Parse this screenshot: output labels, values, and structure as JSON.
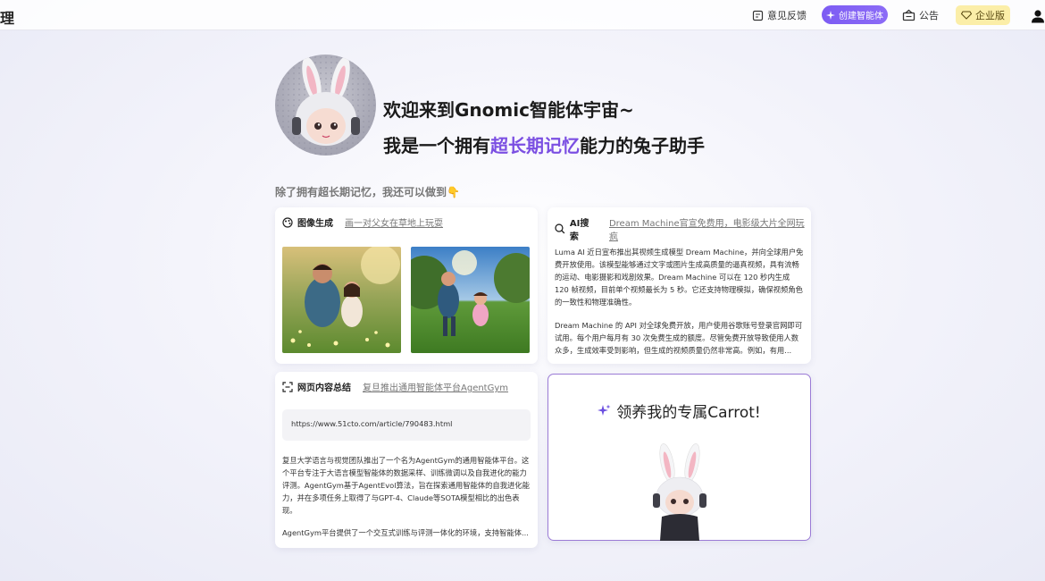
{
  "header": {
    "logo_fragment": "理",
    "feedback_label": "意见反馈",
    "create_agent_label": "创建智能体",
    "notice_label": "公告",
    "enterprise_label": "企业版"
  },
  "hero": {
    "line1": "欢迎来到Gnomic智能体宇宙~",
    "line2_prefix": "我是一个拥有",
    "line2_accent": "超长期记忆",
    "line2_suffix": "能力的兔子助手",
    "accent_color": "#7b4fe2"
  },
  "subhead": "除了拥有超长期记忆，我还可以做到👇",
  "cards": {
    "image_gen": {
      "title": "图像生成",
      "link": "画一对父女在草地上玩耍"
    },
    "ai_search": {
      "title": "AI搜索",
      "link": "Dream Machine官宣免费用，电影级大片全网玩疯",
      "para1": "Luma AI 近日宣布推出其视频生成模型 Dream Machine，并向全球用户免费开放使用。该模型能够通过文字或图片生成高质量的逼真视频，具有流畅的运动、电影摄影和戏剧效果。Dream Machine 可以在 120 秒内生成 120 帧视频，目前单个视频最长为 5 秒。它还支持物理模拟，确保视频角色的一致性和物理准确性。",
      "para2": "Dream Machine 的 API 对全球免费开放，用户使用谷歌账号登录官网即可试用。每个用户每月有 30 次免费生成的额度。尽管免费开放导致使用人数众多，生成效率受到影响，但生成的视频质量仍然非常高。例如，有用..."
    },
    "web_summary": {
      "title": "网页内容总结",
      "link": "复旦推出通用智能体平台AgentGym",
      "url": "https://www.51cto.com/article/790483.html",
      "para1": "复旦大学语言与视觉团队推出了一个名为AgentGym的通用智能体平台。这个平台专注于大语言模型智能体的数据采样、训练微调以及自我进化的能力评测。AgentGym基于AgentEvol算法，旨在探索通用智能体的自我进化能力，并在多项任务上取得了与GPT-4、Claude等SOTA模型相比的出色表现。",
      "para2": "AgentGym平台提供了一个交互式训练与评测一体化的环境，支持智能体..."
    },
    "carrot": {
      "title": "领养我的专属Carrot!",
      "border_color": "#9b7bd6"
    }
  },
  "colors": {
    "create_button": "#7d5cf3",
    "enterprise_bg": "#fbeea8"
  }
}
